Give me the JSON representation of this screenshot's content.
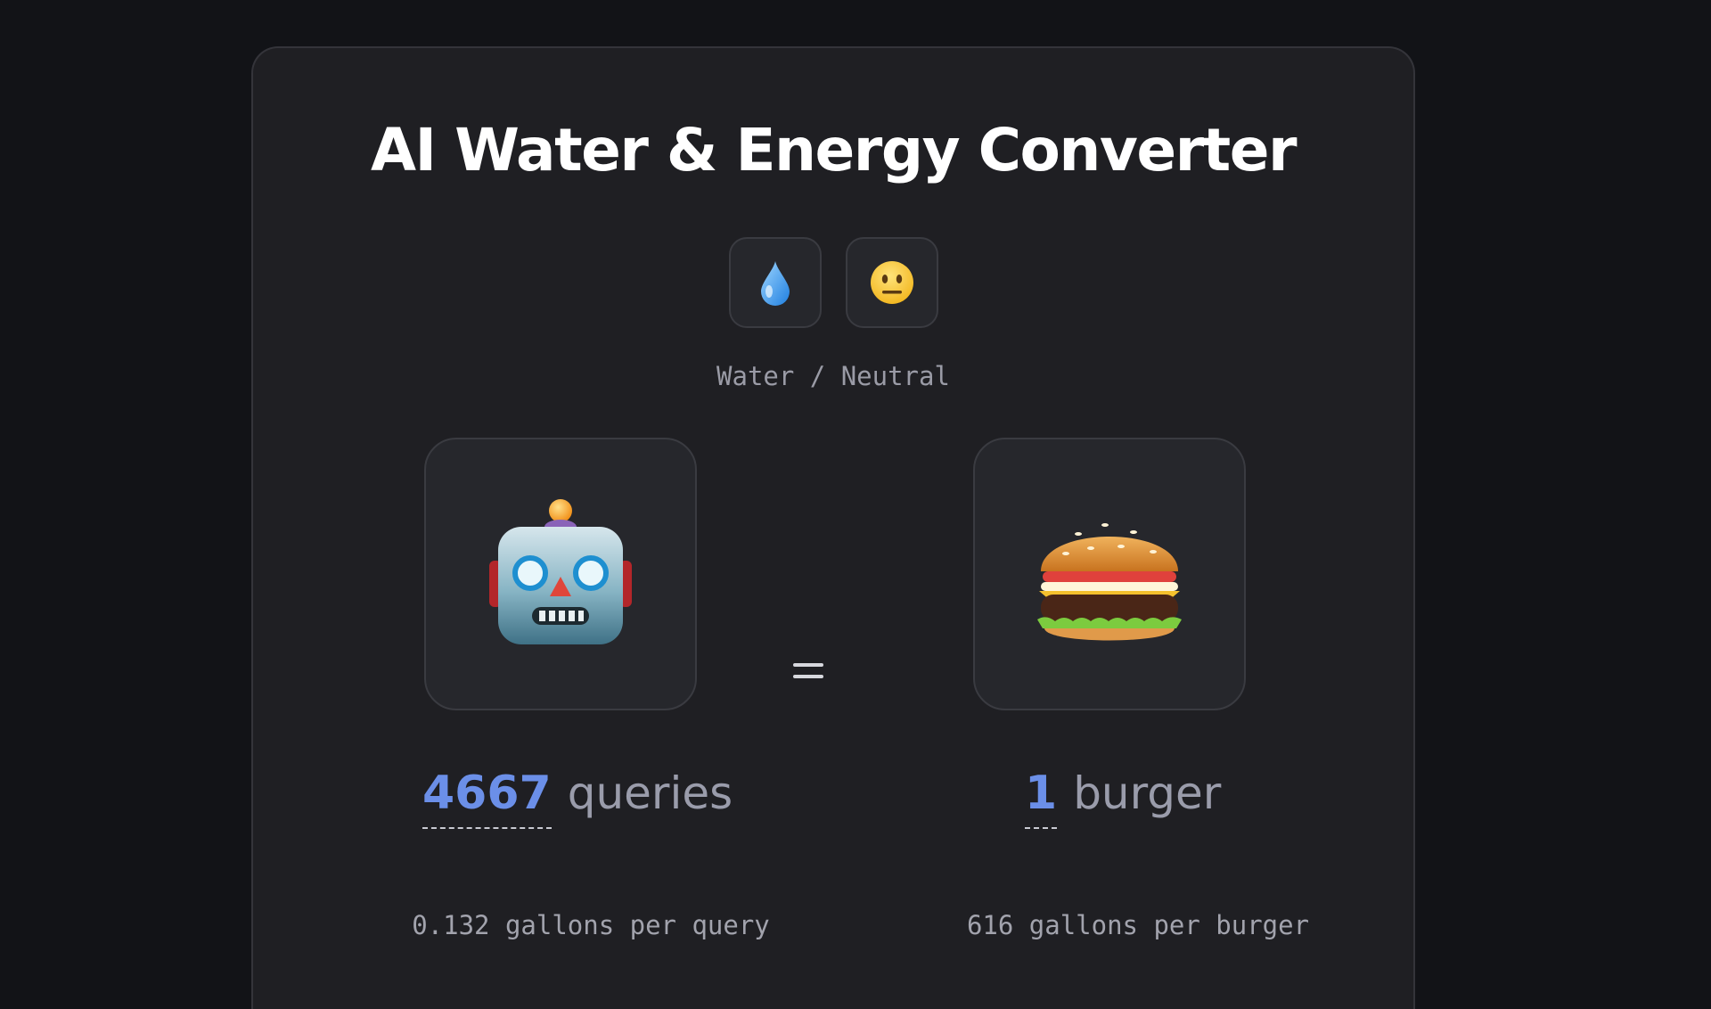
{
  "header": {
    "title": "AI Water & Energy Converter"
  },
  "mode": {
    "buttons": [
      {
        "icon": "water-drop-icon"
      },
      {
        "icon": "neutral-face-icon"
      }
    ],
    "caption": "Water / Neutral"
  },
  "left": {
    "icon": "robot-icon",
    "amount": "4667",
    "unit": "queries",
    "rate": "0.132 gallons per query"
  },
  "right": {
    "icon": "burger-icon",
    "amount": "1",
    "unit": "burger",
    "rate": "616 gallons per burger"
  },
  "colors": {
    "accent": "#6b8fe8",
    "background": "#121317",
    "card": "#1f1f23"
  }
}
